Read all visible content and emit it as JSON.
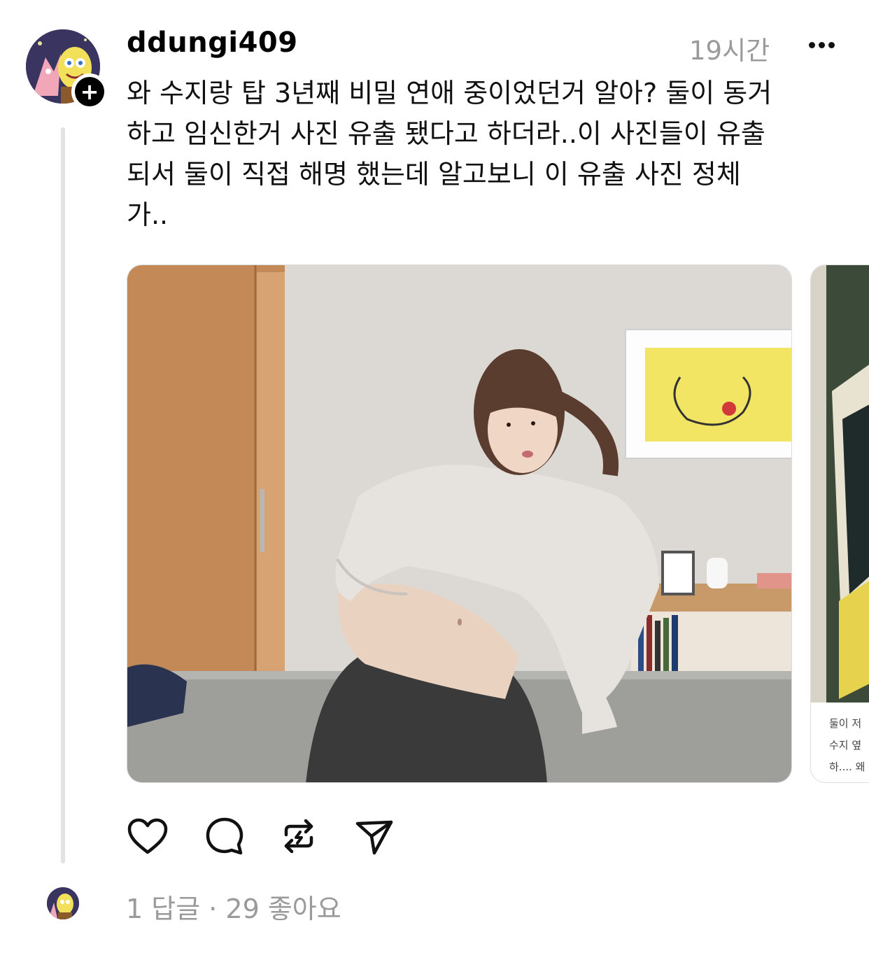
{
  "post": {
    "username": "ddungi409",
    "timestamp": "19시간",
    "text": "와 수지랑 탑 3년째 비밀 연애 중이었던거 알아? 둘이 동거\n하고 임신한거 사진 유출 됐다고 하더라..이 사진들이 유출\n되서 둘이 직접 해명 했는데 알고보니 이 유출 사진 정체\n가..",
    "side_caption": "둘이 저\n수지 옆\n하.... 왜",
    "avatar_icon": "cartoon-avatar-icon",
    "follow_icon": "plus-icon",
    "more_icon": "more-horizontal-icon"
  },
  "actions": {
    "like_icon": "heart-icon",
    "comment_icon": "comment-icon",
    "repost_icon": "repost-icon",
    "share_icon": "send-icon"
  },
  "footer": {
    "stats": "1 답글 · 29 좋아요"
  },
  "colors": {
    "text": "#000000",
    "muted": "#9a9a9a",
    "thread_line": "#e2e2e2"
  }
}
